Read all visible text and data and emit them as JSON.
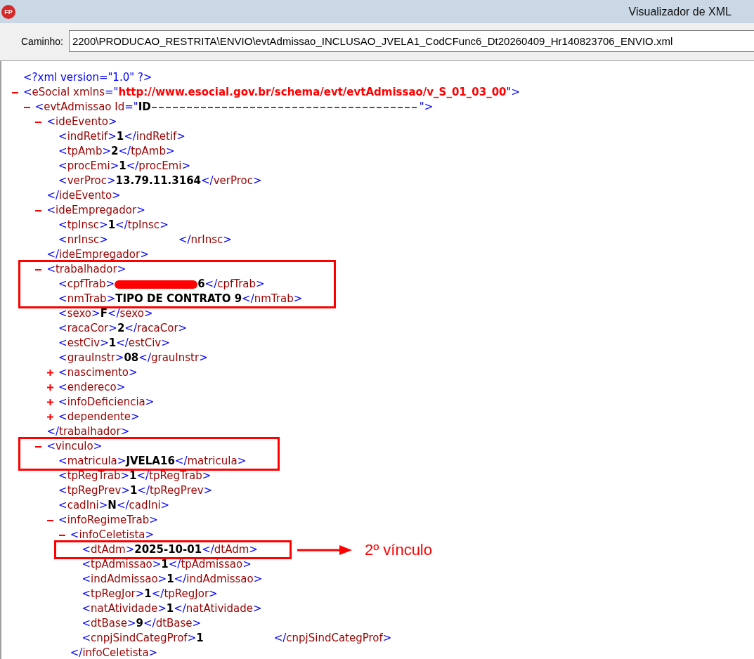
{
  "window": {
    "logo": "FP",
    "title": "Visualizador de XML"
  },
  "path_field": {
    "label": "Caminho:",
    "value": "2200\\PRODUCAO_RESTRITA\\ENVIO\\evtAdmissao_INCLUSAO_JVELA1_CodCFunc6_Dt20260409_Hr140823706_ENVIO.xml"
  },
  "xml_view": {
    "nodes": [
      {
        "kind": "declaration",
        "open": "<?xml version=\"1.0\" ?>",
        "highlighted": false
      },
      {
        "kind": "element",
        "open": "<eSocial xmlns=\"",
        "attribute": {
          "kind": "namespace",
          "value": "http://www.esocial.gov.br/schema/evt/evtAdmissao/v_S_01_03_00"
        },
        "open_end": "\">",
        "expanded": true,
        "highlighted": false,
        "children": [
          {
            "kind": "element",
            "open": "<evtAdmissao Id=\"",
            "attribute": {
              "kind": "plain",
              "value": "ID"
            },
            "redaction_after": {
              "kind": "dashes"
            },
            "open_end": "\">",
            "expanded": true,
            "highlighted": false,
            "children": [
              {
                "kind": "element",
                "open": "<ideEvento>",
                "expanded": true,
                "highlighted": false,
                "children": [
                  {
                    "kind": "leaf",
                    "open": "<indRetif>",
                    "value": "1",
                    "close": "</indRetif>",
                    "highlighted": false
                  },
                  {
                    "kind": "leaf",
                    "open": "<tpAmb>",
                    "value": "2",
                    "close": "</tpAmb>",
                    "highlighted": false
                  },
                  {
                    "kind": "leaf",
                    "open": "<procEmi>",
                    "value": "1",
                    "close": "</procEmi>",
                    "highlighted": false
                  },
                  {
                    "kind": "leaf",
                    "open": "<verProc>",
                    "value": "13.79.11.3164",
                    "close": "</verProc>",
                    "highlighted": false
                  }
                ],
                "close": "</ideEvento>"
              },
              {
                "kind": "element",
                "open": "<ideEmpregador>",
                "expanded": true,
                "highlighted": false,
                "children": [
                  {
                    "kind": "leaf",
                    "open": "<tpInsc>",
                    "value": "1",
                    "close": "</tpInsc>",
                    "highlighted": false
                  },
                  {
                    "kind": "leaf",
                    "open": "<nrInsc>",
                    "redaction_after": {
                      "kind": "blank"
                    },
                    "close": "</nrInsc>",
                    "highlighted": false
                  }
                ],
                "close": "</ideEmpregador>"
              },
              {
                "kind": "element",
                "open": "<trabalhador>",
                "expanded": true,
                "highlighted": true,
                "children": [
                  {
                    "kind": "leaf",
                    "open": "<cpfTrab>",
                    "redaction_before": {
                      "kind": "scribble"
                    },
                    "value": "6",
                    "close": "</cpfTrab>",
                    "highlighted": true
                  },
                  {
                    "kind": "leaf",
                    "open": "<nmTrab>",
                    "value": "TIPO DE CONTRATO 9",
                    "close": "</nmTrab>",
                    "highlighted": true
                  },
                  {
                    "kind": "leaf",
                    "open": "<sexo>",
                    "value": "F",
                    "close": "</sexo>",
                    "highlighted": false
                  },
                  {
                    "kind": "leaf",
                    "open": "<racaCor>",
                    "value": "2",
                    "close": "</racaCor>",
                    "highlighted": false
                  },
                  {
                    "kind": "leaf",
                    "open": "<estCiv>",
                    "value": "1",
                    "close": "</estCiv>",
                    "highlighted": false
                  },
                  {
                    "kind": "leaf",
                    "open": "<grauInstr>",
                    "value": "08",
                    "close": "</grauInstr>",
                    "highlighted": false
                  },
                  {
                    "kind": "element",
                    "open": "<nascimento>",
                    "expanded": false,
                    "highlighted": false
                  },
                  {
                    "kind": "element",
                    "open": "<endereco>",
                    "expanded": false,
                    "highlighted": false
                  },
                  {
                    "kind": "element",
                    "open": "<infoDeficiencia>",
                    "expanded": false,
                    "highlighted": false
                  },
                  {
                    "kind": "element",
                    "open": "<dependente>",
                    "expanded": false,
                    "highlighted": false
                  }
                ],
                "close": "</trabalhador>"
              },
              {
                "kind": "element",
                "open": "<vinculo>",
                "expanded": true,
                "highlighted": true,
                "children": [
                  {
                    "kind": "leaf",
                    "open": "<matricula>",
                    "value": "JVELA16",
                    "close": "</matricula>",
                    "highlighted": true
                  },
                  {
                    "kind": "leaf",
                    "open": "<tpRegTrab>",
                    "value": "1",
                    "close": "</tpRegTrab>",
                    "highlighted": false
                  },
                  {
                    "kind": "leaf",
                    "open": "<tpRegPrev>",
                    "value": "1",
                    "close": "</tpRegPrev>",
                    "highlighted": false
                  },
                  {
                    "kind": "leaf",
                    "open": "<cadIni>",
                    "value": "N",
                    "close": "</cadIni>",
                    "highlighted": false
                  },
                  {
                    "kind": "element",
                    "open": "<infoRegimeTrab>",
                    "expanded": true,
                    "highlighted": false,
                    "children": [
                      {
                        "kind": "element",
                        "open": "<infoCeletista>",
                        "expanded": true,
                        "highlighted": false,
                        "children": [
                          {
                            "kind": "leaf",
                            "open": "<dtAdm>",
                            "value": "2025-10-01",
                            "close": "</dtAdm>",
                            "highlighted": true,
                            "note": "2º vínculo"
                          },
                          {
                            "kind": "leaf",
                            "open": "<tpAdmissao>",
                            "value": "1",
                            "close": "</tpAdmissao>",
                            "highlighted": false
                          },
                          {
                            "kind": "leaf",
                            "open": "<indAdmissao>",
                            "value": "1",
                            "close": "</indAdmissao>",
                            "highlighted": false
                          },
                          {
                            "kind": "leaf",
                            "open": "<tpRegJor>",
                            "value": "1",
                            "close": "</tpRegJor>",
                            "highlighted": false
                          },
                          {
                            "kind": "leaf",
                            "open": "<natAtividade>",
                            "value": "1",
                            "close": "</natAtividade>",
                            "highlighted": false
                          },
                          {
                            "kind": "leaf",
                            "open": "<dtBase>",
                            "value": "9",
                            "close": "</dtBase>",
                            "highlighted": false
                          },
                          {
                            "kind": "leaf",
                            "open": "<cnpjSindCategProf>",
                            "value": "1",
                            "redaction_after": {
                              "kind": "blank"
                            },
                            "close": "</cnpjSindCategProf>",
                            "highlighted": false
                          }
                        ],
                        "close": "</infoCeletista>"
                      }
                    ]
                  }
                ]
              }
            ]
          }
        ]
      }
    ]
  }
}
